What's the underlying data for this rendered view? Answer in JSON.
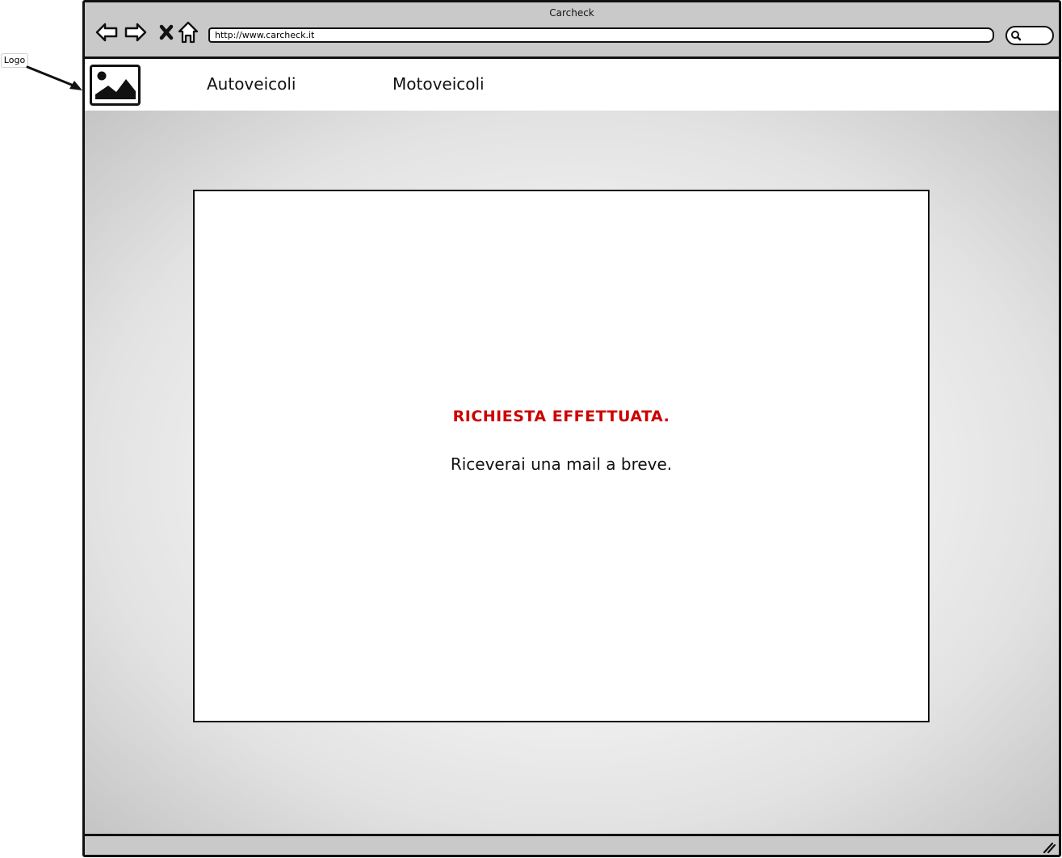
{
  "annotation": {
    "label": "Logo"
  },
  "window": {
    "title": "Carcheck"
  },
  "toolbar": {
    "back_icon": "back-arrow-icon",
    "forward_icon": "forward-arrow-icon",
    "stop_icon": "close-icon",
    "home_icon": "home-icon",
    "search_icon": "search-icon"
  },
  "address_bar": {
    "url": "http://www.carcheck.it"
  },
  "header": {
    "logo_icon": "image-placeholder-icon",
    "nav": [
      {
        "label": "Autoveicoli"
      },
      {
        "label": "Motoveicoli"
      }
    ]
  },
  "message": {
    "title": "RICHIESTA EFFETTUATA.",
    "body": "Riceverai una mail a breve.",
    "title_color": "#cc0000"
  }
}
